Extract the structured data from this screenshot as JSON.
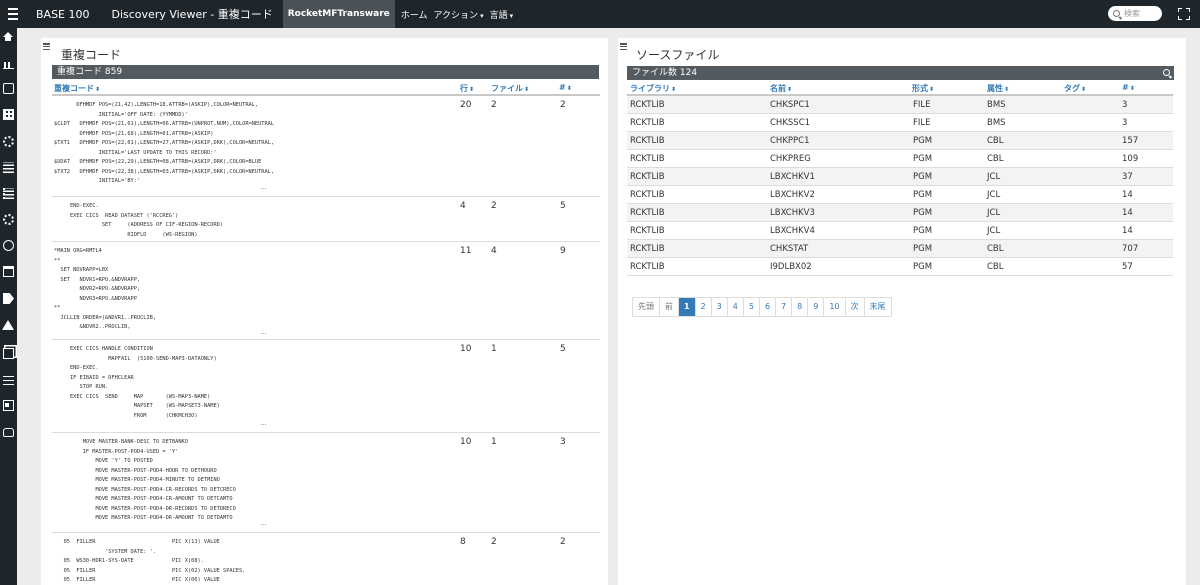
{
  "topbar": {
    "brand": "BASE 100",
    "title": "Discovery Viewer - 重複コード",
    "nav": [
      {
        "label": "RocketMFTransware"
      },
      {
        "label": "ホーム"
      },
      {
        "label": "アクション"
      },
      {
        "label": "言語"
      }
    ],
    "search_placeholder": "検索"
  },
  "sidebar": {
    "icons": [
      "home-icon",
      "bar-chart-icon",
      "square-icon",
      "table-icon",
      "settings-icon",
      "list-icon",
      "list-icon",
      "share-icon",
      "circle-icon",
      "calendar-icon",
      "tag-icon",
      "warning-icon",
      "copy-icon",
      "sliders-icon",
      "id-card-icon",
      "lock-icon"
    ]
  },
  "left_panel": {
    "title": "重複コード",
    "bar": "重複コード 859",
    "headers": {
      "code": "重複コード",
      "lines": "行",
      "files": "ファイル",
      "count": "#"
    },
    "rows": [
      {
        "code": "       DFHMDF POS=(21,42),LENGTH=18,ATTRB=(ASKIP),COLOR=NEUTRAL,\n              INITIAL='OFF DATE: (YYMMDD)'\n$CLDT   DFHMDF POS=(21,61),LENGTH=06,ATTRB=(UNPROT,NUM),COLOR=NEUTRAL\n        DFHMDF POS=(21,68),LENGTH=01,ATTRB=(ASKIP)\n$TXT1   DFHMDF POS=(22,01),LENGTH=27,ATTRB=(ASKIP,DRK),COLOR=NEUTRAL,\n              INITIAL='LAST UPDATE TO THIS RECORD:'\n$UDAT   DFHMDF POS=(22,29),LENGTH=08,ATTRB=(ASKIP,DRK),COLOR=BLUE\n$TXT2   DFHMDF POS=(22,38),LENGTH=03,ATTRB=(ASKIP,DRK),COLOR=NEUTRAL,\n              INITIAL='BY:'",
        "ellipsis": "...",
        "lines": "20",
        "files": "2",
        "count": "2"
      },
      {
        "code": "     END-EXEC.\n     EXEC CICS  READ DATASET ('RCCREG')\n               SET     (ADDRESS OF CIF-REGION-RECORD)\n                       RIDFLD     (WS-REGION)",
        "ellipsis": "",
        "lines": "4",
        "files": "2",
        "count": "5"
      },
      {
        "code": "*MAIN ORG=RMTL4\n**\n  SET NDVRAPP=LBX\n  SET   NDVR1=RPO.&NDVRAPP,\n        NDVR2=RPO.&NDVRAPP,\n        NDVR3=RPO.&NDVRAPP\n**\n  JCLLIB ORDER=(&NDVR1..PROCLIB,\n        &NDVR2..PROCLIB,",
        "ellipsis": "...",
        "lines": "11",
        "files": "4",
        "count": "9"
      },
      {
        "code": "     EXEC CICS HANDLE CONDITION\n                 MAPFAIL  (5100-SEND-MAP3-DATAONLY)\n     END-EXEC.\n     IF EIBAID = DFHCLEAR\n        STOP RUN.\n     EXEC CICS  SEND     MAP       (WS-MAP3-NAME)\n                         MAPSET    (WS-MAPSET3-NAME)\n                         FROM      (CHKMCH3O)",
        "ellipsis": "...",
        "lines": "10",
        "files": "1",
        "count": "5"
      },
      {
        "code": "         MOVE MASTER-BANK-DESC TO DETBANKO\n         IF MASTER-POST-POD4-USED = 'Y'\n             MOVE 'Y' TO POSTED\n             MOVE MASTER-POST-POD4-HOUR TO DETHOURO\n             MOVE MASTER-POST-POD4-MINUTE TO DETMINO\n             MOVE MASTER-POST-POD4-CR-RECORDS TO DETCRECO\n             MOVE MASTER-POST-POD4-CR-AMOUNT TO DETCAMTO\n             MOVE MASTER-POST-POD4-DR-RECORDS TO DETDRECO\n             MOVE MASTER-POST-POD4-DR-AMOUNT TO DETDAMTO",
        "ellipsis": "...",
        "lines": "10",
        "files": "1",
        "count": "3"
      },
      {
        "code": "   05  FILLER                        PIC X(13) VALUE\n                'SYSTEM DATE: '.\n   05  WS30-HDR1-SYS-DATE            PIC X(08).\n   05  FILLER                        PIC X(02) VALUE SPACES.\n   05  FILLER                        PIC X(06) VALUE",
        "ellipsis": "",
        "lines": "8",
        "files": "2",
        "count": "2"
      }
    ]
  },
  "right_panel": {
    "title": "ソースファイル",
    "bar": "ファイル数 124",
    "headers": {
      "library": "ライブラリ",
      "name": "名前",
      "format": "形式",
      "attribute": "属性",
      "tag": "タグ",
      "count": "#"
    },
    "rows": [
      {
        "library": "RCKTLIB",
        "name": "CHKSPC1",
        "format": "FILE",
        "attribute": "BMS",
        "tag": "",
        "count": "3"
      },
      {
        "library": "RCKTLIB",
        "name": "CHKSSC1",
        "format": "FILE",
        "attribute": "BMS",
        "tag": "",
        "count": "3"
      },
      {
        "library": "RCKTLIB",
        "name": "CHKPPC1",
        "format": "PGM",
        "attribute": "CBL",
        "tag": "",
        "count": "157"
      },
      {
        "library": "RCKTLIB",
        "name": "CHKPREG",
        "format": "PGM",
        "attribute": "CBL",
        "tag": "",
        "count": "109"
      },
      {
        "library": "RCKTLIB",
        "name": "LBXCHKV1",
        "format": "PGM",
        "attribute": "JCL",
        "tag": "",
        "count": "37"
      },
      {
        "library": "RCKTLIB",
        "name": "LBXCHKV2",
        "format": "PGM",
        "attribute": "JCL",
        "tag": "",
        "count": "14"
      },
      {
        "library": "RCKTLIB",
        "name": "LBXCHKV3",
        "format": "PGM",
        "attribute": "JCL",
        "tag": "",
        "count": "14"
      },
      {
        "library": "RCKTLIB",
        "name": "LBXCHKV4",
        "format": "PGM",
        "attribute": "JCL",
        "tag": "",
        "count": "14"
      },
      {
        "library": "RCKTLIB",
        "name": "CHKSTAT",
        "format": "PGM",
        "attribute": "CBL",
        "tag": "",
        "count": "707"
      },
      {
        "library": "RCKTLIB",
        "name": "I9DLBX02",
        "format": "PGM",
        "attribute": "CBL",
        "tag": "",
        "count": "57"
      }
    ],
    "pagination": [
      "先頭",
      "前",
      "1",
      "2",
      "3",
      "4",
      "5",
      "6",
      "7",
      "8",
      "9",
      "10",
      "次",
      "末尾"
    ],
    "active_page": "1"
  },
  "colors": {
    "topbar": "#1f262b",
    "bar": "#535b61",
    "accent": "#337ab7"
  }
}
